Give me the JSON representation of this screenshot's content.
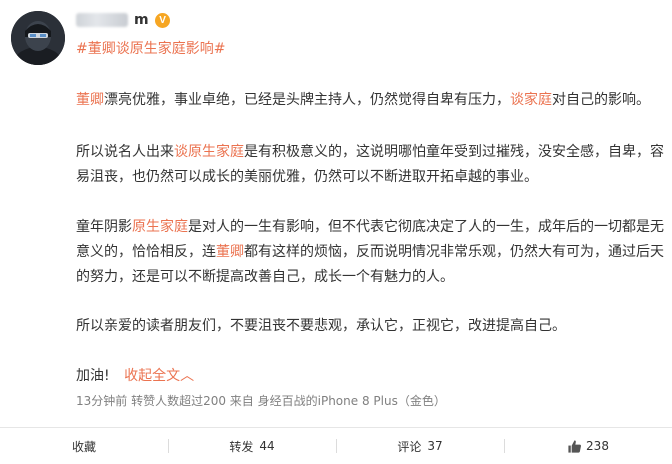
{
  "header": {
    "name_suffix": "m",
    "vip_label": "V",
    "topic": "#董卿谈原生家庭影响#"
  },
  "post": {
    "p1": {
      "s1": "董卿",
      "s2": "漂亮优雅，事业卓绝，已经是头牌主持人，仍然觉得自卑有压力，",
      "s3": "谈家庭",
      "s4": "对自己的影响。"
    },
    "p2": {
      "s1": "所以说名人出来",
      "s2": "谈原生家庭",
      "s3": "是有积极意义的，这说明哪怕童年受到过摧残，没安全感，自卑，容易沮丧，也仍然可以成长的美丽优雅，仍然可以不断进取开拓卓越的事业。"
    },
    "p3": {
      "s1": "童年阴影",
      "s2": "原生家庭",
      "s3": "是对人的一生有影响，但不代表它彻底决定了人的一生，成年后的一切都是无意义的，恰恰相反，连",
      "s4": "董卿",
      "s5": "都有这样的烦恼，反而说明情况非常乐观，仍然大有可为，通过后天的努力，还是可以不断提高改善自己，成长一个有魅力的人。"
    },
    "p4": "所以亲爱的读者朋友们，不要沮丧不要悲观，承认它，正视它，改进提高自己。",
    "cheer": "加油!",
    "collapse_label": "收起全文",
    "collapse_arrow": "︿",
    "meta": "13分钟前 转赞人数超过200 来自 身经百战的iPhone 8 Plus（金色）"
  },
  "actions": {
    "favorite_label": "收藏",
    "repost_label": "转发",
    "repost_count": "44",
    "comment_label": "评论",
    "comment_count": "37",
    "like_icon": "thumbs-up-icon",
    "like_count": "238"
  },
  "colors": {
    "highlight": "#eb7350",
    "text": "#333333",
    "meta": "#808080"
  }
}
